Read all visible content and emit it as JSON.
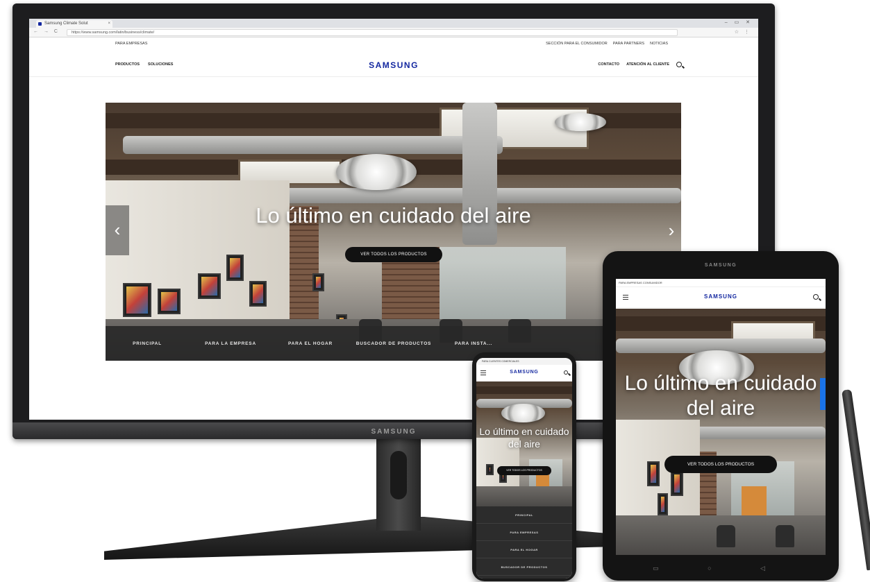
{
  "browser": {
    "tab_title": "Samsung Climate Solut",
    "tab_close": "×",
    "window_controls": "– ▭ ✕",
    "nav_icons": "← → C",
    "url": "https://www.samsung.com/latin/business/climate/",
    "addr_icons": "☆ ⋮"
  },
  "site": {
    "top_left": "PARA EMPRESAS",
    "top_links": [
      "SECCIÓN PARA EL CONSUMIDOR",
      "PARA PARTNERS",
      "NOTICIAS"
    ],
    "nav_left": [
      "PRODUCTOS",
      "SOLUCIONES"
    ],
    "logo": "SAMSUNG",
    "nav_right": [
      "CONTACTO",
      "ATENCIÓN AL CLIENTE"
    ]
  },
  "hero": {
    "title": "Lo último en cuidado del aire",
    "cta": "VER TODOS LOS PRODUCTOS",
    "prev_arrow": "‹",
    "next_arrow": "›",
    "bar_items": [
      "PRINCIPAL",
      "PARA LA EMPRESA",
      "PARA EL HOGAR",
      "BUSCADOR DE PRODUCTOS",
      "PARA INSTA..."
    ]
  },
  "monitor": {
    "brand": "SAMSUNG"
  },
  "tablet": {
    "brand": "SAMSUNG",
    "top_text": "PARA EMPRESAS CONSUMIDOR",
    "logo": "SAMSUNG",
    "title": "Lo último en cuidado del aire",
    "cta": "VER TODOS LOS PRODUCTOS",
    "softkeys": "▭ ○ ◁"
  },
  "phone": {
    "top_text": "PARA CLIENTES COMERCIALES",
    "logo": "SAMSUNG",
    "title": "Lo último en cuidado del aire",
    "cta": "VER TODOS LOS PRODUCTOS",
    "menu_items": [
      "PRINCIPAL",
      "PARA EMPRESAS",
      "PARA EL HOGAR",
      "BUSCADOR DE PRODUCTOS"
    ]
  },
  "colors": {
    "brand_blue": "#1428a0",
    "bar_dark": "#282828"
  }
}
